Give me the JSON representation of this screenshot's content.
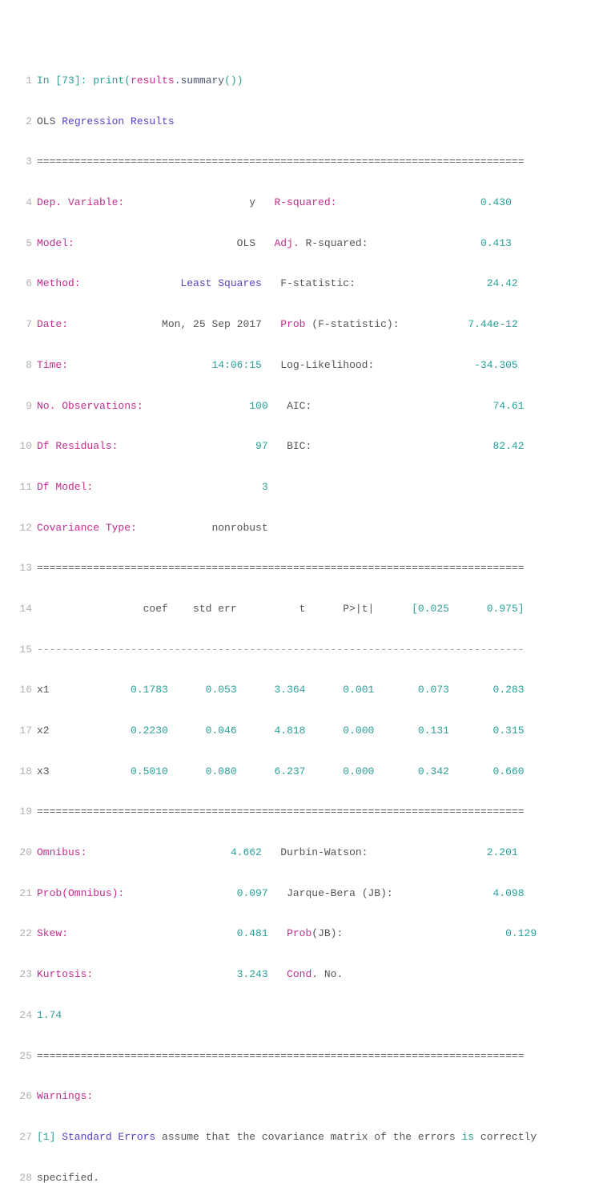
{
  "lines": [
    {
      "n": "1"
    },
    {
      "n": "2"
    },
    {
      "n": "3"
    },
    {
      "n": "4"
    },
    {
      "n": "5"
    },
    {
      "n": "6"
    },
    {
      "n": "7"
    },
    {
      "n": "8"
    },
    {
      "n": "9"
    },
    {
      "n": "10"
    },
    {
      "n": "11"
    },
    {
      "n": "12"
    },
    {
      "n": "13"
    },
    {
      "n": "14"
    },
    {
      "n": "15"
    },
    {
      "n": "16"
    },
    {
      "n": "17"
    },
    {
      "n": "18"
    },
    {
      "n": "19"
    },
    {
      "n": "20"
    },
    {
      "n": "21"
    },
    {
      "n": "22"
    },
    {
      "n": "23"
    },
    {
      "n": "24"
    },
    {
      "n": "25"
    },
    {
      "n": "26"
    },
    {
      "n": "27"
    },
    {
      "n": "28"
    }
  ],
  "code": {
    "in_kw": "In",
    "in_num": "[73]:",
    "print": "print",
    "results": "results",
    "dot": ".",
    "summary": "summary",
    "p_open": "(",
    "p_close": ")",
    "p_close2": ")"
  },
  "title": {
    "ols": "OLS",
    "rest": "Regression Results"
  },
  "rule_eq_full": "==============================================================================",
  "rule_eq_coef": "==============================================================================",
  "rule_dash": "------------------------------------------------------------------------------",
  "top": {
    "r": [
      {
        "l1": "Dep. Variable:",
        "v1": "                    y",
        "l2": "R-squared:",
        "v2": "                       0.430"
      },
      {
        "l1": "Model:",
        "v1": "                          OLS",
        "l2a": "Adj.",
        "l2b": " R-squared:",
        "v2": "                  0.413"
      },
      {
        "l1": "Method:",
        "v1": "                Least Squares",
        "l2": "F-statistic:",
        "v2": "                     24.42"
      },
      {
        "l1": "Date:",
        "v1": "               Mon, 25 Sep 2017",
        "l2a": "Prob",
        "l2b": " (F-statistic):",
        "v2": "           7.44e-12"
      },
      {
        "l1": "Time:",
        "v1": "                       14:06:15",
        "l2": "Log-Likelihood:",
        "v2": "                -34.305"
      },
      {
        "l1": "No. Observations:",
        "v1": "                 100",
        "l2": "AIC:",
        "v2": "                             74.61"
      },
      {
        "l1": "Df Residuals:",
        "v1": "                      97",
        "l2": "BIC:",
        "v2": "                             82.42"
      },
      {
        "l1": "Df Model:",
        "v1": "                           3"
      },
      {
        "l1": "Covariance Type:",
        "v1": "            nonrobust"
      }
    ]
  },
  "coefs": {
    "hdr": {
      "a": "                 coef",
      "b": "    std err",
      "c": "          t",
      "d": "      P>|t|",
      "e": "      [0.025",
      "f": "      0.975]"
    },
    "rows": [
      {
        "n": "x1",
        "a": "             0.1783",
        "b": "      0.053",
        "c": "      3.364",
        "d": "      0.001",
        "e": "       0.073",
        "f": "       0.283"
      },
      {
        "n": "x2",
        "a": "             0.2230",
        "b": "      0.046",
        "c": "      4.818",
        "d": "      0.000",
        "e": "       0.131",
        "f": "       0.315"
      },
      {
        "n": "x3",
        "a": "             0.5010",
        "b": "      0.080",
        "c": "      6.237",
        "d": "      0.000",
        "e": "       0.342",
        "f": "       0.660"
      }
    ]
  },
  "diag": {
    "r": [
      {
        "l1": "Omnibus:",
        "v1": "                       4.662",
        "l2": "Durbin-Watson:",
        "v2": "                   2.201"
      },
      {
        "l1": "Prob(Omnibus):",
        "v1": "                  0.097",
        "l2a": "Jarque-Bera",
        "l2b": " (JB):",
        "v2": "                4.098"
      },
      {
        "l1": "Skew:",
        "v1": "                           0.481",
        "l2a": "Prob",
        "l2b": "(JB):",
        "v2": "                          0.129"
      },
      {
        "l1": "Kurtosis:",
        "v1": "                       3.243",
        "l2a": "Cond",
        "l2b": ". No."
      }
    ],
    "extra": "1.74"
  },
  "warn": {
    "hdr": "Warnings:",
    "idx": "[1]",
    "se": " Standard Errors",
    "mid": " assume that the covariance matrix of the errors ",
    "is": "is",
    "tail": " correctly",
    "line2": "specified."
  }
}
